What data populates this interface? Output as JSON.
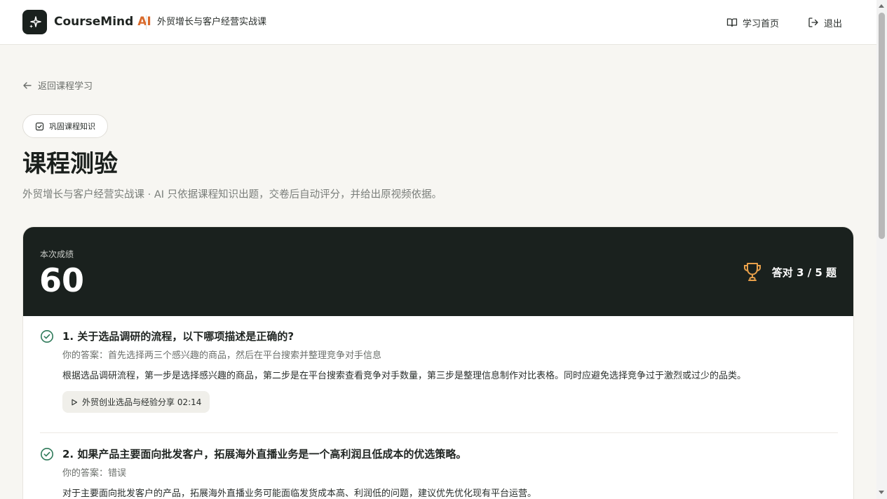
{
  "header": {
    "brand_name": "CourseMind",
    "brand_ai": "AI",
    "course_name": "外贸增长与客户经营实战课",
    "nav_home": "学习首页",
    "nav_exit": "退出"
  },
  "page": {
    "back_label": "返回课程学习",
    "pill_label": "巩固课程知识",
    "title": "课程测验",
    "subtitle": "外贸增长与客户经营实战课 · AI 只依据课程知识出题，交卷后自动评分，并给出原视频依据。"
  },
  "result": {
    "score_label": "本次成绩",
    "score": "60",
    "correct_text": "答对 3 / 5 题"
  },
  "questions": [
    {
      "title": "1. 关于选品调研的流程，以下哪项描述是正确的?",
      "answer": "你的答案：首先选择两三个感兴趣的商品，然后在平台搜索并整理竞争对手信息",
      "explanation": "根据选品调研流程，第一步是选择感兴趣的商品，第二步是在平台搜索查看竞争对手数量，第三步是整理信息制作对比表格。同时应避免选择竞争过于激烈或过少的品类。",
      "source": "外贸创业选品与经验分享 02:14"
    },
    {
      "title": "2. 如果产品主要面向批发客户，拓展海外直播业务是一个高利润且低成本的优选策略。",
      "answer": "你的答案：错误",
      "explanation": "对于主要面向批发客户的产品，拓展海外直播业务可能面临发货成本高、利润低的问题，建议优先优化现有平台运营。"
    }
  ],
  "colors": {
    "accent": "#d96a2b",
    "dark": "#1a211e",
    "correct": "#2f7a5a",
    "trophy": "#e8a04a"
  }
}
